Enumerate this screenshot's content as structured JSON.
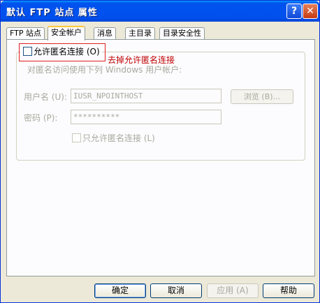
{
  "window": {
    "title": "默认 FTP 站点 属性"
  },
  "titlebar": {
    "help_glyph": "?",
    "close_glyph": "✕"
  },
  "tabs": [
    {
      "label": "FTP 站点"
    },
    {
      "label": "安全帐户"
    },
    {
      "label": "消息"
    },
    {
      "label": "主目录"
    },
    {
      "label": "目录安全性"
    }
  ],
  "active_tab": "安全帐户",
  "anonymous": {
    "allow_label": "允许匿名连接 (O)",
    "allow_checked": false,
    "annotation": "去掉允许匿名连接",
    "description": "对匿名访问使用下列 Windows 用户帐户:",
    "username_label": "用户名 (U):",
    "username_value": "IUSR_NPOINTHOST",
    "browse_label": "浏览 (B)...",
    "password_label": "密码 (P):",
    "password_value": "**********",
    "only_anonymous_label": "只允许匿名连接 (L)",
    "only_anonymous_checked": false
  },
  "buttons": {
    "ok": "确定",
    "cancel": "取消",
    "apply": "应用 (A)",
    "help": "帮助"
  },
  "colors": {
    "titlebar": "#0053ee",
    "window_bg": "#ece9d8",
    "annotation": "#c00000",
    "highlight_box": "#e02020"
  }
}
